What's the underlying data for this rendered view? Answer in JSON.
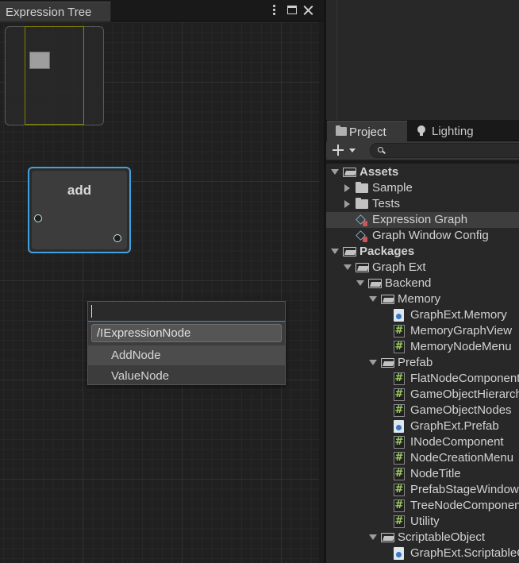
{
  "graph_window": {
    "tab_title": "Expression Tree",
    "node": {
      "title": "add"
    },
    "search_popup": {
      "query": "",
      "path": "/IExpressionNode",
      "items": [
        "AddNode",
        "ValueNode"
      ]
    }
  },
  "project_window": {
    "tabs": [
      {
        "label": "Project",
        "icon": "folder-icon"
      },
      {
        "label": "Lighting",
        "icon": "lightbulb-icon"
      }
    ],
    "search_placeholder": "",
    "tree": [
      {
        "label": "Assets",
        "bold": true,
        "expanded": true,
        "icon": "folder-open-icon",
        "depth": 0
      },
      {
        "label": "Sample",
        "expanded": false,
        "icon": "folder-icon",
        "depth": 1
      },
      {
        "label": "Tests",
        "expanded": false,
        "icon": "folder-icon",
        "depth": 1
      },
      {
        "label": "Expression Graph",
        "icon": "scriptable-object-icon",
        "depth": 1,
        "selected": true
      },
      {
        "label": "Graph Window Config",
        "icon": "scriptable-object-icon",
        "depth": 1
      },
      {
        "label": "Packages",
        "bold": true,
        "expanded": true,
        "icon": "folder-open-icon",
        "depth": 0
      },
      {
        "label": "Graph Ext",
        "expanded": true,
        "icon": "folder-open-icon",
        "depth": 1
      },
      {
        "label": "Backend",
        "expanded": true,
        "icon": "folder-open-icon",
        "depth": 2
      },
      {
        "label": "Memory",
        "expanded": true,
        "icon": "folder-open-icon",
        "depth": 3
      },
      {
        "label": "GraphExt.Memory",
        "icon": "assembly-definition-icon",
        "depth": 4
      },
      {
        "label": "MemoryGraphView",
        "icon": "csharp-script-icon",
        "depth": 4
      },
      {
        "label": "MemoryNodeMenu",
        "icon": "csharp-script-icon",
        "depth": 4
      },
      {
        "label": "Prefab",
        "expanded": true,
        "icon": "folder-open-icon",
        "depth": 3
      },
      {
        "label": "FlatNodeComponent",
        "icon": "csharp-script-icon",
        "depth": 4
      },
      {
        "label": "GameObjectHierarchy",
        "icon": "csharp-script-icon",
        "depth": 4
      },
      {
        "label": "GameObjectNodes",
        "icon": "csharp-script-icon",
        "depth": 4
      },
      {
        "label": "GraphExt.Prefab",
        "icon": "assembly-definition-icon",
        "depth": 4
      },
      {
        "label": "INodeComponent",
        "icon": "csharp-script-icon",
        "depth": 4
      },
      {
        "label": "NodeCreationMenu",
        "icon": "csharp-script-icon",
        "depth": 4
      },
      {
        "label": "NodeTitle",
        "icon": "csharp-script-icon",
        "depth": 4
      },
      {
        "label": "PrefabStageWindow",
        "icon": "csharp-script-icon",
        "depth": 4
      },
      {
        "label": "TreeNodeComponent",
        "icon": "csharp-script-icon",
        "depth": 4
      },
      {
        "label": "Utility",
        "icon": "csharp-script-icon",
        "depth": 4
      },
      {
        "label": "ScriptableObject",
        "expanded": true,
        "icon": "folder-open-icon",
        "depth": 3
      },
      {
        "label": "GraphExt.ScriptableObject",
        "icon": "assembly-definition-icon",
        "depth": 4
      }
    ]
  }
}
